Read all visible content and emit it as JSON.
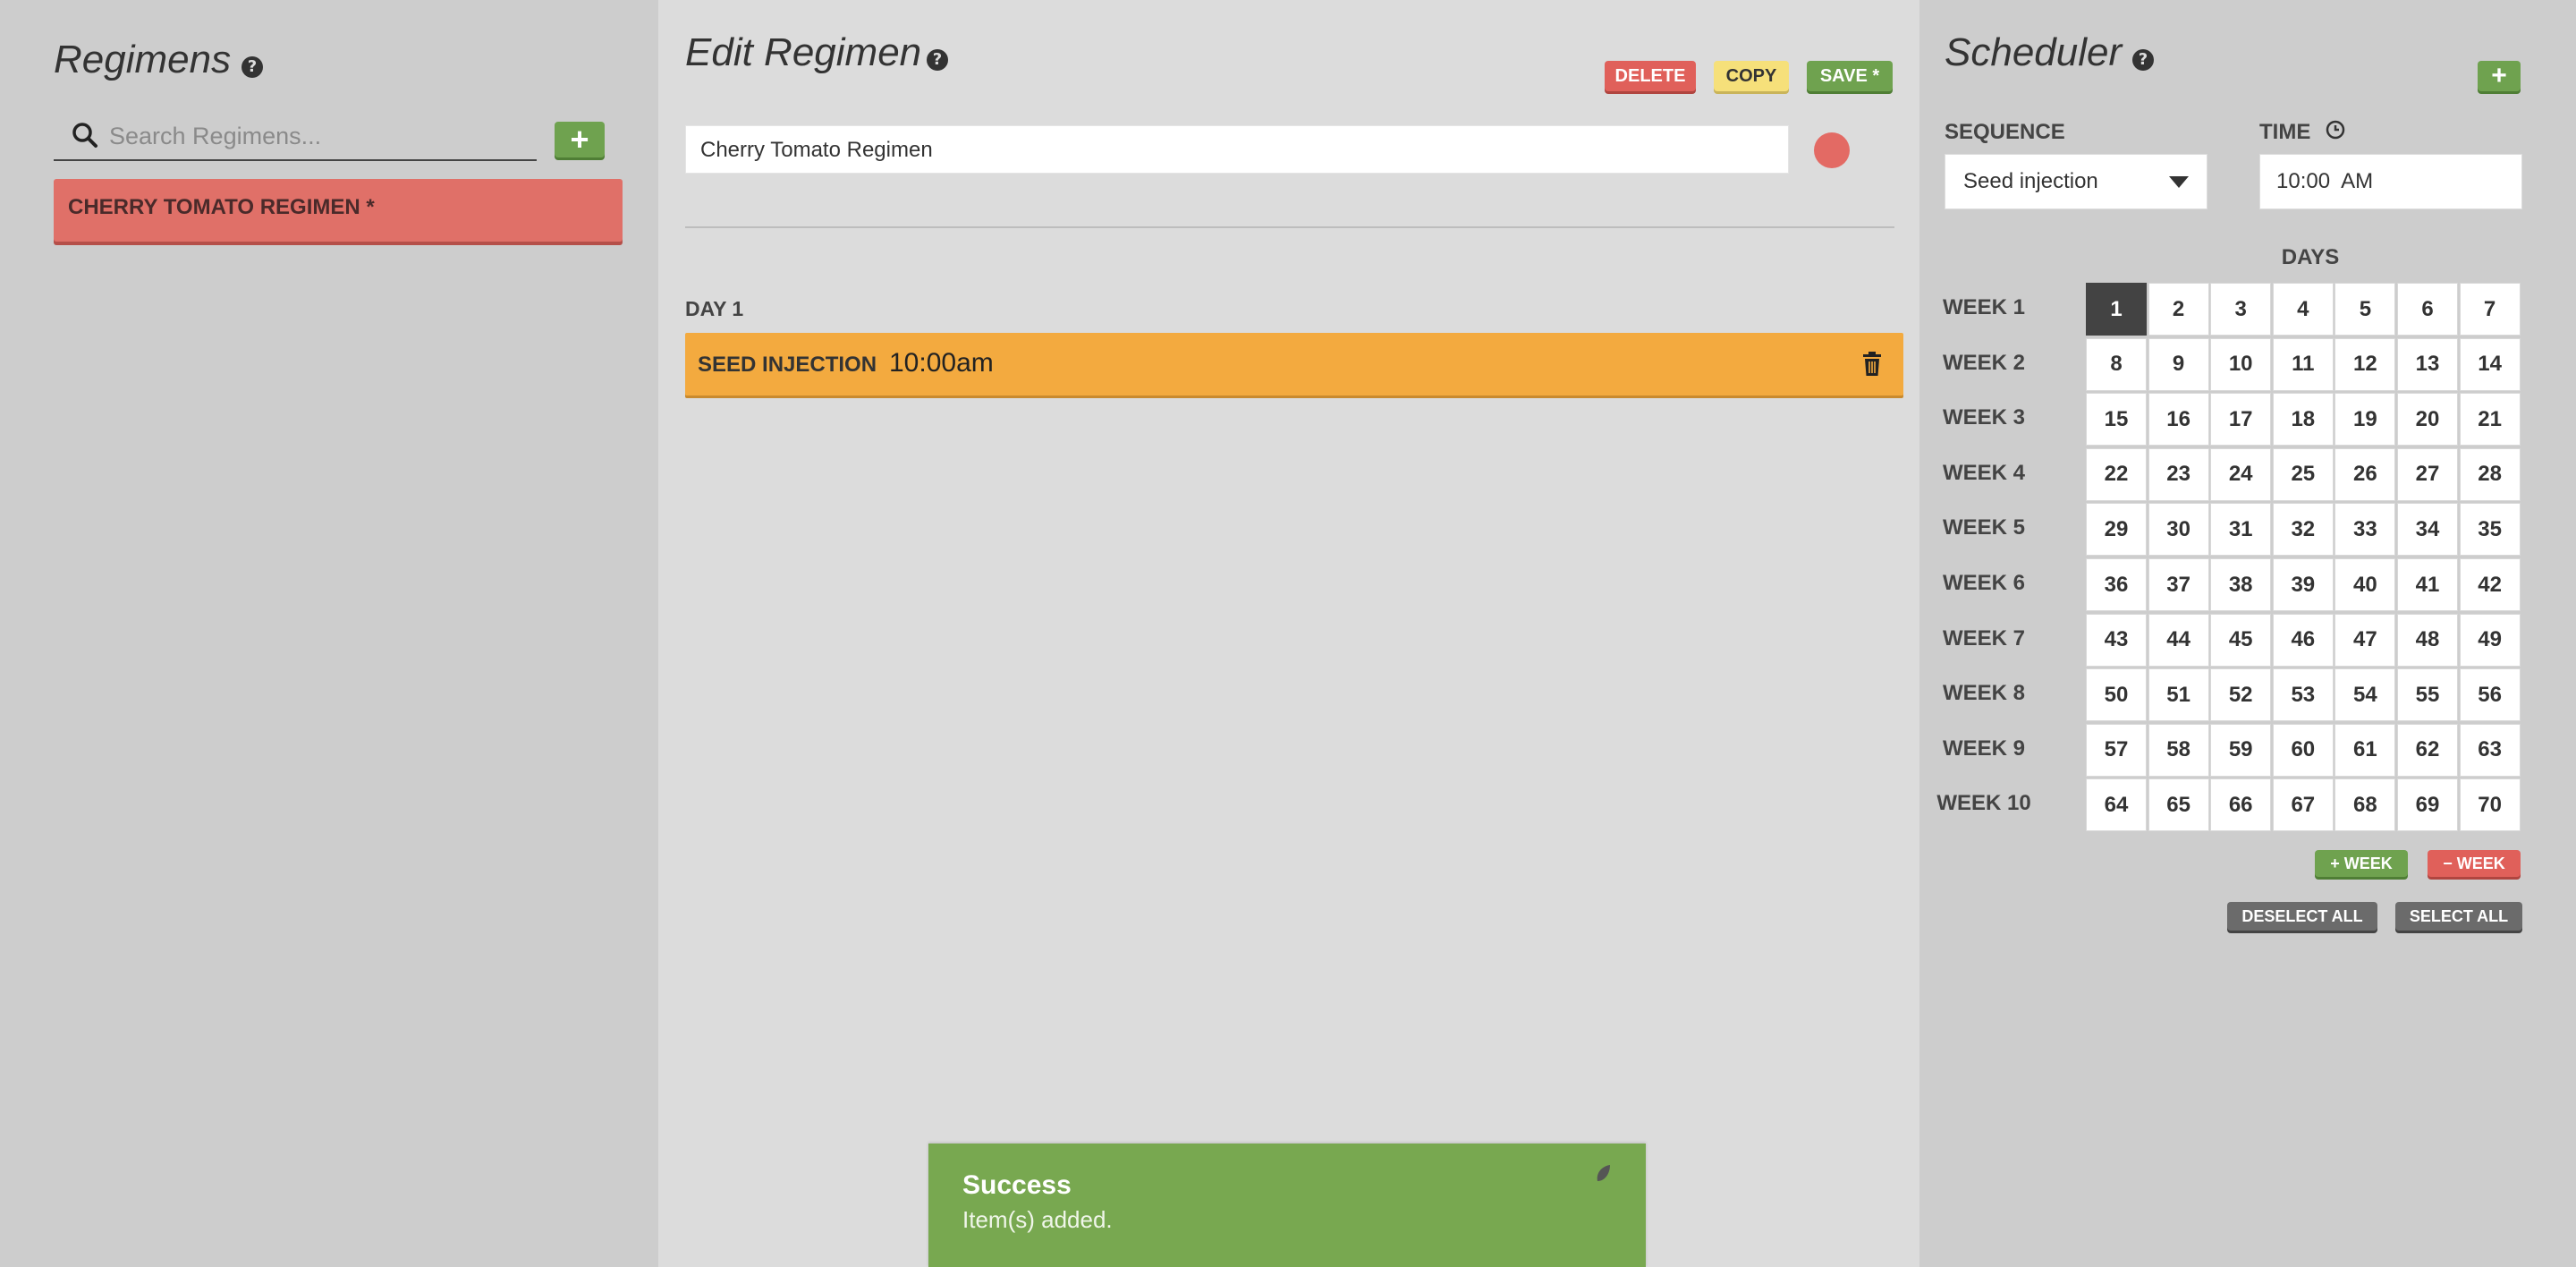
{
  "regimens_panel": {
    "title": "Regimens",
    "search_placeholder": "Search Regimens...",
    "add_label": "+",
    "items": [
      {
        "label": "CHERRY TOMATO REGIMEN *",
        "color": "#e07068"
      }
    ]
  },
  "editor": {
    "title": "Edit Regimen",
    "delete_label": "DELETE",
    "copy_label": "COPY",
    "save_label": "SAVE *",
    "name_value": "Cherry Tomato Regimen",
    "color": "#e36a64",
    "days": [
      {
        "label": "DAY 1",
        "items": [
          {
            "name": "SEED INJECTION",
            "time": "10:00am",
            "color": "#f3aa3f"
          }
        ]
      }
    ]
  },
  "toast": {
    "title": "Success",
    "message": "Item(s) added."
  },
  "scheduler": {
    "title": "Scheduler",
    "add_label": "+",
    "sequence_label": "SEQUENCE",
    "sequence_value": "Seed injection",
    "time_label": "TIME",
    "time_value": "10:00  AM",
    "days_label": "DAYS",
    "selected_days": [
      1
    ],
    "weeks": [
      {
        "label": "WEEK 1",
        "days": [
          1,
          2,
          3,
          4,
          5,
          6,
          7
        ]
      },
      {
        "label": "WEEK 2",
        "days": [
          8,
          9,
          10,
          11,
          12,
          13,
          14
        ]
      },
      {
        "label": "WEEK 3",
        "days": [
          15,
          16,
          17,
          18,
          19,
          20,
          21
        ]
      },
      {
        "label": "WEEK 4",
        "days": [
          22,
          23,
          24,
          25,
          26,
          27,
          28
        ]
      },
      {
        "label": "WEEK 5",
        "days": [
          29,
          30,
          31,
          32,
          33,
          34,
          35
        ]
      },
      {
        "label": "WEEK 6",
        "days": [
          36,
          37,
          38,
          39,
          40,
          41,
          42
        ]
      },
      {
        "label": "WEEK 7",
        "days": [
          43,
          44,
          45,
          46,
          47,
          48,
          49
        ]
      },
      {
        "label": "WEEK 8",
        "days": [
          50,
          51,
          52,
          53,
          54,
          55,
          56
        ]
      },
      {
        "label": "WEEK 9",
        "days": [
          57,
          58,
          59,
          60,
          61,
          62,
          63
        ]
      },
      {
        "label": "WEEK 10",
        "days": [
          64,
          65,
          66,
          67,
          68,
          69,
          70
        ]
      }
    ],
    "add_week_label": "+ WEEK",
    "remove_week_label": "− WEEK",
    "deselect_all_label": "DESELECT ALL",
    "select_all_label": "SELECT ALL"
  },
  "colors": {
    "accent_green": "#6fa24f",
    "danger_red": "#e0605a",
    "copy_yellow": "#f6e07a",
    "sequence_orange": "#f3aa3f",
    "toast_green": "#78a850"
  }
}
